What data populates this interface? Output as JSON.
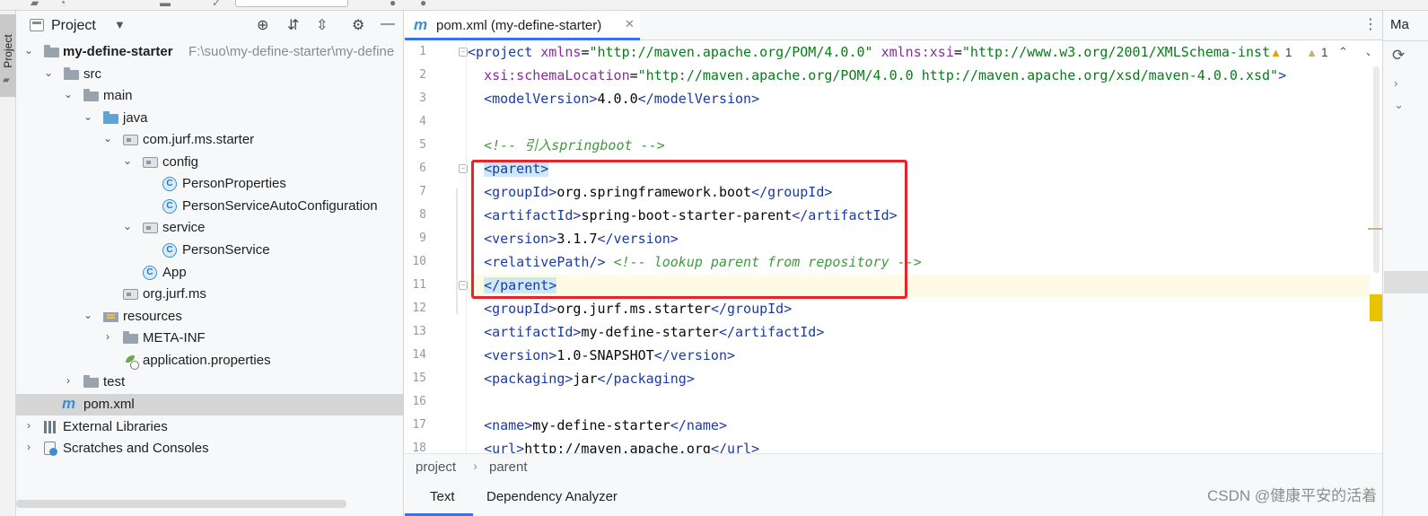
{
  "project_panel": {
    "title": "Project",
    "tree": [
      {
        "label": "my-define-starter",
        "path": "F:\\suo\\my-define-starter\\my-define",
        "bold": true
      },
      {
        "label": "src"
      },
      {
        "label": "main"
      },
      {
        "label": "java"
      },
      {
        "label": "com.jurf.ms.starter"
      },
      {
        "label": "config"
      },
      {
        "label": "PersonProperties"
      },
      {
        "label": "PersonServiceAutoConfiguration"
      },
      {
        "label": "service"
      },
      {
        "label": "PersonService"
      },
      {
        "label": "App"
      },
      {
        "label": "org.jurf.ms"
      },
      {
        "label": "resources"
      },
      {
        "label": "META-INF"
      },
      {
        "label": "application.properties"
      },
      {
        "label": "test"
      },
      {
        "label": "pom.xml",
        "selected": true
      },
      {
        "label": "External Libraries"
      },
      {
        "label": "Scratches and Consoles"
      }
    ]
  },
  "editor": {
    "tab_label": "pom.xml (my-define-starter)",
    "inspection": {
      "warn1": "1",
      "warn2": "1"
    },
    "line_numbers": [
      "1",
      "2",
      "3",
      "4",
      "5",
      "6",
      "7",
      "8",
      "9",
      "10",
      "11",
      "12",
      "13",
      "14",
      "15",
      "16",
      "17",
      "18"
    ],
    "lines": [
      {
        "html": "<span class=\"tag\">&lt;project</span> <span class=\"attr\">xmlns</span>=<span class=\"val\">\"http://maven.apache.org/POM/4.0.0\"</span> <span class=\"attr\">xmlns:xsi</span>=<span class=\"val\">\"http://www.w3.org/2001/XMLSchema-inst</span>"
      },
      {
        "html": "  <span class=\"attr\">xsi:schemaLocation</span>=<span class=\"val\">\"http://maven.apache.org/POM/4.0.0 http://maven.apache.org/xsd/maven-4.0.0.xsd\"</span><span class=\"tag\">&gt;</span>"
      },
      {
        "html": "  <span class=\"tag\">&lt;modelVersion&gt;</span>4.0.0<span class=\"tag\">&lt;/modelVersion&gt;</span>"
      },
      {
        "html": ""
      },
      {
        "html": "  <span class=\"cmt\">&lt;!-- 引入springboot --&gt;</span>"
      },
      {
        "html": "  <span class=\"tag hl-tag\">&lt;parent&gt;</span>"
      },
      {
        "html": "  <span class=\"tag\">&lt;groupId&gt;</span>org.springframework.boot<span class=\"tag\">&lt;/groupId&gt;</span>"
      },
      {
        "html": "  <span class=\"tag\">&lt;artifactId&gt;</span>spring-boot-starter-parent<span class=\"tag\">&lt;/artifactId&gt;</span>"
      },
      {
        "html": "  <span class=\"tag\">&lt;version&gt;</span>3.1.7<span class=\"tag\">&lt;/version&gt;</span>"
      },
      {
        "html": "  <span class=\"tag\">&lt;relativePath/&gt;</span> <span class=\"cmt\">&lt;!-- lookup parent from repository --&gt;</span>"
      },
      {
        "html": "  <span class=\"tag hl-tag\">&lt;/parent&gt;</span>",
        "current": true
      },
      {
        "html": "  <span class=\"tag\">&lt;groupId&gt;</span>org.jurf.ms.starter<span class=\"tag\">&lt;/groupId&gt;</span>"
      },
      {
        "html": "  <span class=\"tag\">&lt;artifactId&gt;</span>my-define-starter<span class=\"tag\">&lt;/artifactId&gt;</span>"
      },
      {
        "html": "  <span class=\"tag\">&lt;version&gt;</span>1.0-SNAPSHOT<span class=\"tag\">&lt;/version&gt;</span>"
      },
      {
        "html": "  <span class=\"tag\">&lt;packaging&gt;</span>jar<span class=\"tag\">&lt;/packaging&gt;</span>"
      },
      {
        "html": ""
      },
      {
        "html": "  <span class=\"tag\">&lt;name&gt;</span>my-define-starter<span class=\"tag\">&lt;/name&gt;</span>"
      },
      {
        "html": "  <span class=\"tag\">&lt;url&gt;</span>http://maven.apache.org<span class=\"tag\">&lt;/url&gt;</span>"
      }
    ],
    "breadcrumb": [
      "project",
      "parent"
    ],
    "bottom_tabs": [
      "Text",
      "Dependency Analyzer"
    ]
  },
  "right_panel": {
    "title": "Ma"
  },
  "watermark": "CSDN @健康平安的活着",
  "colors": {
    "accent": "#3574f0",
    "highlight_box": "#e8242b",
    "warning": "#e3a300"
  }
}
